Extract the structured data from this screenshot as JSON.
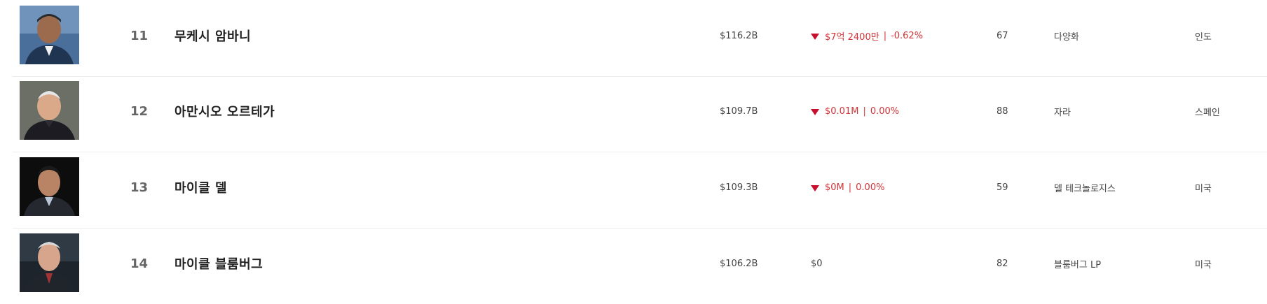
{
  "rows": [
    {
      "rank": "11",
      "name": "무케시 암바니",
      "net_worth": "$116.2B",
      "change_amount": "$7억 2400만",
      "change_percent": "-0.62%",
      "change_direction": "down",
      "age": "67",
      "source": "다양화",
      "country": "인도",
      "photo_icon": "person-photo"
    },
    {
      "rank": "12",
      "name": "아만시오 오르테가",
      "net_worth": "$109.7B",
      "change_amount": "$0.01M",
      "change_percent": "0.00%",
      "change_direction": "down",
      "age": "88",
      "source": "자라",
      "country": "스페인",
      "photo_icon": "person-photo"
    },
    {
      "rank": "13",
      "name": "마이클 델",
      "net_worth": "$109.3B",
      "change_amount": "$0M",
      "change_percent": "0.00%",
      "change_direction": "down",
      "age": "59",
      "source": "델 테크놀로지스",
      "country": "미국",
      "photo_icon": "person-photo"
    },
    {
      "rank": "14",
      "name": "마이클 블룸버그",
      "net_worth": "$106.2B",
      "change_amount": "$0",
      "change_direction": "none",
      "age": "82",
      "source": "블룸버그 LP",
      "country": "미국",
      "photo_icon": "person-photo"
    }
  ],
  "colors": {
    "negative": "#d13438",
    "arrow": "#c8102e",
    "divider": "#ececec"
  }
}
